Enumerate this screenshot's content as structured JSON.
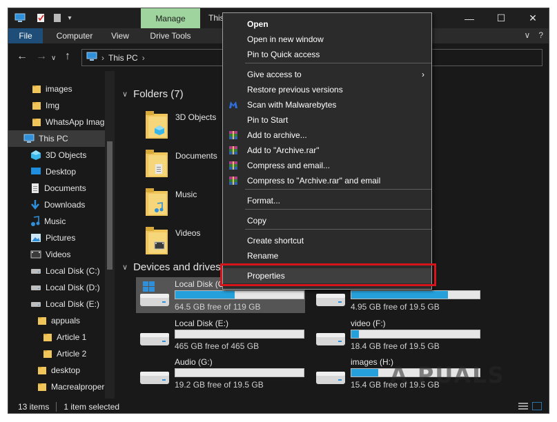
{
  "window": {
    "title_partial": "This",
    "manage_tab": "Manage",
    "minimize": "—",
    "maximize": "☐",
    "close": "✕"
  },
  "ribbon": {
    "tabs": [
      "File",
      "Computer",
      "View",
      "Drive Tools"
    ],
    "collapse_glyph": "∨",
    "help_glyph": "?"
  },
  "address": {
    "location": "This PC",
    "chevron": "›"
  },
  "sidebar": {
    "items": [
      {
        "label": "images",
        "icon": "folder-icon"
      },
      {
        "label": "Img",
        "icon": "folder-icon"
      },
      {
        "label": "WhatsApp Imag",
        "icon": "folder-icon"
      },
      {
        "label": "This PC",
        "icon": "computer-icon",
        "selected": true
      },
      {
        "label": "3D Objects",
        "icon": "cube-icon"
      },
      {
        "label": "Desktop",
        "icon": "desktop-icon"
      },
      {
        "label": "Documents",
        "icon": "document-icon"
      },
      {
        "label": "Downloads",
        "icon": "download-icon"
      },
      {
        "label": "Music",
        "icon": "music-icon"
      },
      {
        "label": "Pictures",
        "icon": "picture-icon"
      },
      {
        "label": "Videos",
        "icon": "video-icon"
      },
      {
        "label": "Local Disk (C:)",
        "icon": "drive-icon"
      },
      {
        "label": "Local Disk (D:)",
        "icon": "drive-icon"
      },
      {
        "label": "Local Disk (E:)",
        "icon": "drive-icon"
      },
      {
        "label": "appuals",
        "icon": "folder-icon"
      },
      {
        "label": "Article 1",
        "icon": "folder-icon"
      },
      {
        "label": "Article 2",
        "icon": "folder-icon"
      },
      {
        "label": "desktop",
        "icon": "folder-icon"
      },
      {
        "label": "Macrealproper",
        "icon": "folder-icon"
      }
    ]
  },
  "content": {
    "folders_header": "Folders (7)",
    "folders": [
      "3D Objects",
      "Documents",
      "Music",
      "Videos"
    ],
    "devices_header": "Devices and drives",
    "drives": [
      {
        "name": "Local Disk (C:)",
        "free": "64.5 GB free of 119 GB",
        "used_fraction": 0.46,
        "selected": true
      },
      {
        "name": "",
        "free": "4.95 GB free of 19.5 GB",
        "used_fraction": 0.75
      },
      {
        "name": "Local Disk (E:)",
        "free": "465 GB free of 465 GB",
        "used_fraction": 0.0
      },
      {
        "name": "video (F:)",
        "free": "18.4 GB free of 19.5 GB",
        "used_fraction": 0.06
      },
      {
        "name": "Audio (G:)",
        "free": "19.2 GB free of 19.5 GB",
        "used_fraction": 0.0
      },
      {
        "name": "images (H:)",
        "free": "15.4 GB free of 19.5 GB",
        "used_fraction": 0.21
      }
    ]
  },
  "context_menu": {
    "items": [
      {
        "label": "Open",
        "bold": true
      },
      {
        "label": "Open in new window"
      },
      {
        "label": "Pin to Quick access"
      },
      {
        "label": "Give access to",
        "submenu": true
      },
      {
        "label": "Restore previous versions"
      },
      {
        "label": "Scan with Malwarebytes",
        "icon": "malwarebytes-icon"
      },
      {
        "label": "Pin to Start"
      },
      {
        "label": "Add to archive...",
        "icon": "winrar-icon"
      },
      {
        "label": "Add to \"Archive.rar\"",
        "icon": "winrar-icon"
      },
      {
        "label": "Compress and email...",
        "icon": "winrar-icon"
      },
      {
        "label": "Compress to \"Archive.rar\" and email",
        "icon": "winrar-icon"
      },
      {
        "label": "Format..."
      },
      {
        "label": "Copy"
      },
      {
        "label": "Create shortcut"
      },
      {
        "label": "Rename"
      },
      {
        "label": "Properties",
        "highlighted": true
      }
    ],
    "submenu_arrow": "›"
  },
  "status": {
    "items_count": "13 items",
    "selected": "1 item selected"
  },
  "watermark": "A  PUALS",
  "colors": {
    "accent": "#26a0da",
    "manage_tab": "#9fd49f",
    "highlight_border": "#d6141a",
    "file_tab": "#1e4d78"
  }
}
